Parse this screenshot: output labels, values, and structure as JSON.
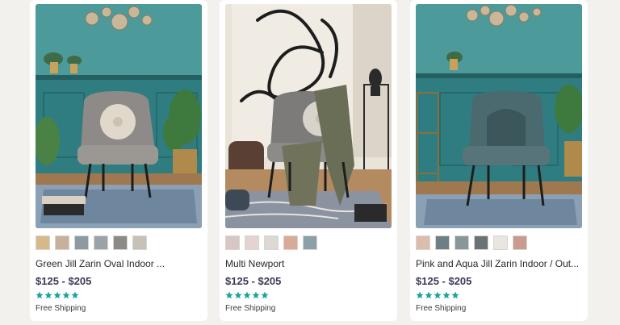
{
  "products": [
    {
      "title": "Green Jill Zarin Oval Indoor ...",
      "price": "$125 - $205",
      "rating": 5,
      "shipping": "Free Shipping",
      "swatch_colors": [
        "#d6b98a",
        "#c9b09a",
        "#8e9aa2",
        "#9aa3a8",
        "#8c8a86",
        "#c8c1b8"
      ]
    },
    {
      "title": "Multi Newport",
      "price": "$125 - $205",
      "rating": 5,
      "shipping": "Free Shipping",
      "swatch_colors": [
        "#d8c6c6",
        "#e4d3d0",
        "#dcd8d2",
        "#d9a99a",
        "#8ca0a8"
      ]
    },
    {
      "title": "Pink and Aqua Jill Zarin Indoor / Out...",
      "price": "$125 - $205",
      "rating": 5,
      "shipping": "Free Shipping",
      "swatch_colors": [
        "#dcbcaa",
        "#6d7e84",
        "#87979a",
        "#6a7276",
        "#e9e5e0",
        "#c99a90"
      ]
    }
  ],
  "colors": {
    "star": "#1aa39a",
    "price": "#3a3a55",
    "wall_teal": "#3a8a8c"
  },
  "icons": [
    "star-icon"
  ]
}
